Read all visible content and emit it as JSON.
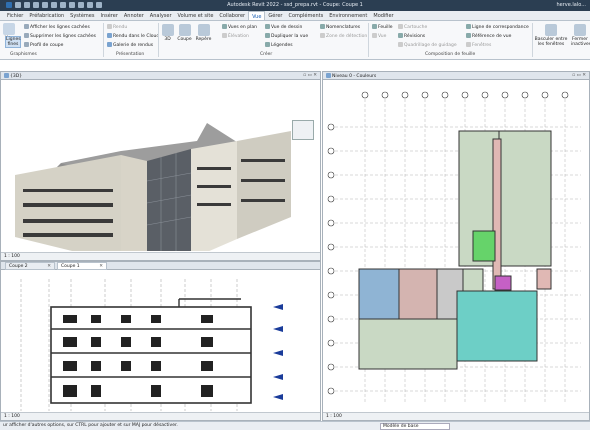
{
  "window": {
    "title": "Autodesk Revit 2022 - ssd_prepa.rvt - Coupe: Coupe 1",
    "user": "herve.lalo..."
  },
  "menu_tabs": [
    "Fichier",
    "Préfabrication",
    "Systèmes",
    "Insérer",
    "Annoter",
    "Analyser",
    "Volume et site",
    "Collaborer",
    "Vue",
    "Gérer",
    "Compléments",
    "Environnement",
    "Modifier"
  ],
  "ribbon": {
    "graphismes": {
      "big": [
        "Vue",
        "Lignes fines"
      ],
      "items": [
        "Afficher les lignes cachées",
        "Supprimer les lignes cachées",
        "Profil de coupe"
      ],
      "label": "Graphismes"
    },
    "presentation": {
      "items": [
        "Rendu",
        "Rendu dans le Cloud",
        "Galerie de rendus"
      ],
      "label": "Présentation"
    },
    "creer": {
      "big": [
        "3D",
        "Coupe",
        "Repère"
      ],
      "col1": [
        "Vues en plan",
        "Élévation",
        "Légendes"
      ],
      "col2": [
        "Vue de dessin",
        "Dupliquer la vue",
        "Zone de détection"
      ],
      "col3": [
        "Nomenclatures"
      ],
      "label": "Créer"
    },
    "feuille": {
      "col1": [
        "Feuille",
        "Vue"
      ],
      "col2": [
        "Cartouche",
        "Révisions",
        "Quadrillage de guidage"
      ],
      "col3": [
        "Ligne de correspondance",
        "Référence de vue",
        "Fenêtres"
      ],
      "label": "Composition de feuille"
    },
    "fenetres": {
      "big": [
        "Basculer entre les fenêtres",
        "Fermer inactives"
      ]
    }
  },
  "views": {
    "v3d": {
      "tab": "{3D}",
      "scale": "1 : 100"
    },
    "plan": {
      "tab": "Niveau 0 - Couleurs",
      "scale": "1 : 100"
    },
    "section": {
      "tabs": [
        "Coupe 2",
        "Coupe 1"
      ],
      "scale": "1 : 100"
    }
  },
  "status": {
    "hint": "ur afficher d'autres options, sur CTRL pour ajouter et sur MAJ pour désactiver.",
    "model": "Modèle de base"
  }
}
